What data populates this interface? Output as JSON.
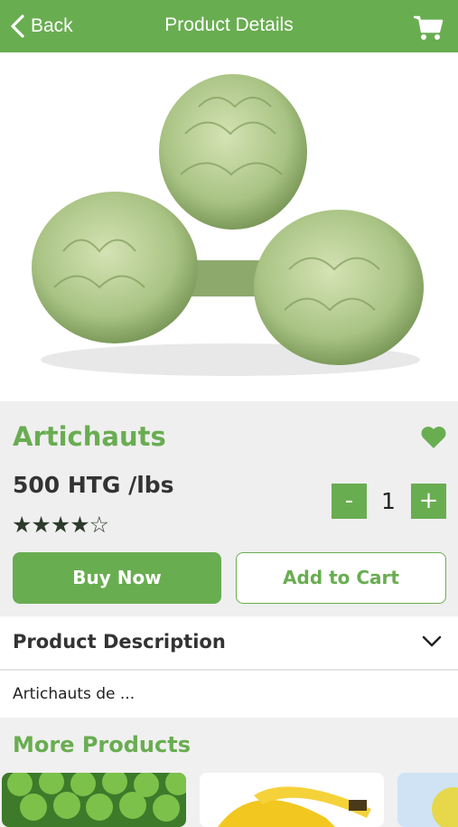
{
  "header": {
    "back_label": "Back",
    "title": "Product Details"
  },
  "product": {
    "name": "Artichauts",
    "price": "500 HTG /lbs",
    "rating": 4,
    "rating_max": 5,
    "stars_text": "★★★★☆",
    "quantity": "1",
    "buy_label": "Buy Now",
    "add_label": "Add to Cart"
  },
  "qty": {
    "minus": "-",
    "plus": "+"
  },
  "description": {
    "title": "Product Description",
    "text": "Artichauts de ..."
  },
  "more": {
    "title": "More Products"
  },
  "colors": {
    "brand": "#69ad51",
    "background": "#f0f0f0",
    "dark_text": "#333333"
  },
  "icons": [
    "chevron-left-icon",
    "cart-icon",
    "heart-icon",
    "chevron-down-icon"
  ]
}
